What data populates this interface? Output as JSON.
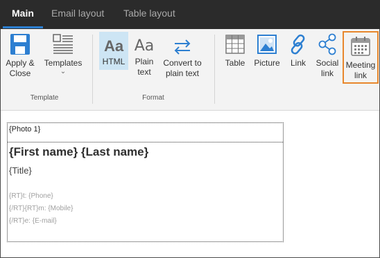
{
  "tabs": [
    {
      "label": "Main",
      "active": true
    },
    {
      "label": "Email layout",
      "active": false
    },
    {
      "label": "Table layout",
      "active": false
    }
  ],
  "ribbon": {
    "template_group": {
      "label": "Template",
      "apply_close": {
        "line1": "Apply &",
        "line2": "Close",
        "icon": "save-icon"
      },
      "templates": {
        "label": "Templates",
        "chevron": "⌄",
        "icon": "templates-icon"
      }
    },
    "format_group": {
      "label": "Format",
      "html": {
        "label": "HTML",
        "icon_text": "Aa",
        "selected": true
      },
      "plain_text": {
        "line1": "Plain",
        "line2": "text",
        "icon_text": "Aa"
      },
      "convert": {
        "line1": "Convert to",
        "line2": "plain text",
        "icon": "convert-arrows-icon"
      }
    },
    "insert_group": {
      "table": {
        "label": "Table",
        "icon": "table-icon"
      },
      "picture": {
        "label": "Picture",
        "icon": "picture-icon"
      },
      "link": {
        "label": "Link",
        "icon": "link-icon"
      },
      "social": {
        "line1": "Social",
        "line2": "link",
        "icon": "share-icon"
      },
      "meeting": {
        "line1": "Meeting",
        "line2": "link",
        "icon": "calendar-icon",
        "highlighted": true
      }
    }
  },
  "signature": {
    "photo": "{Photo 1}",
    "name": "{First name} {Last name}",
    "title": "{Title}",
    "phone": "{RT}t: {Phone}",
    "mobile": "{/RT}{RT}m: {Mobile}",
    "email": "{/RT}e: {E-mail}"
  },
  "colors": {
    "tabbar_bg": "#2b2b2b",
    "accent": "#2d7fd1",
    "highlight": "#e8872c",
    "selected_bg": "#cde5f4"
  }
}
